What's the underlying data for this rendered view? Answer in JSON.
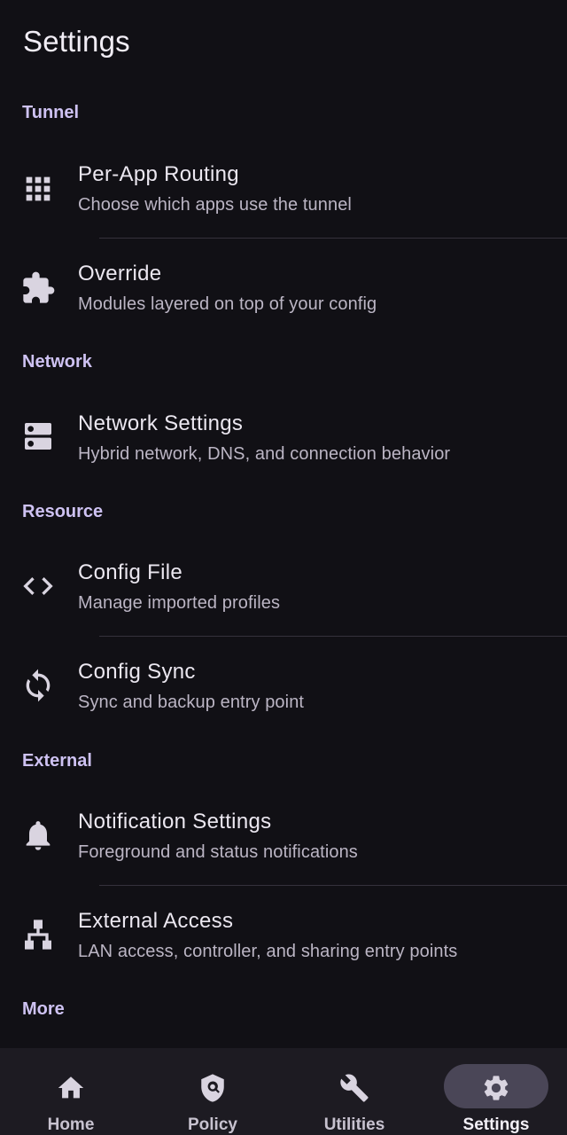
{
  "header": {
    "title": "Settings"
  },
  "sections": {
    "tunnel": "Tunnel",
    "network": "Network",
    "resource": "Resource",
    "external": "External",
    "more": "More"
  },
  "items": {
    "per_app": {
      "title": "Per-App Routing",
      "subtitle": "Choose which apps use the tunnel",
      "icon": "apps-grid-icon"
    },
    "override": {
      "title": "Override",
      "subtitle": "Modules layered on top of your config",
      "icon": "puzzle-icon"
    },
    "network_settings": {
      "title": "Network Settings",
      "subtitle": "Hybrid network, DNS, and connection behavior",
      "icon": "server-icon"
    },
    "config_file": {
      "title": "Config File",
      "subtitle": "Manage imported profiles",
      "icon": "code-icon"
    },
    "config_sync": {
      "title": "Config Sync",
      "subtitle": "Sync and backup entry point",
      "icon": "sync-icon"
    },
    "notification": {
      "title": "Notification Settings",
      "subtitle": "Foreground and status notifications",
      "icon": "bell-icon"
    },
    "external_access": {
      "title": "External Access",
      "subtitle": "LAN access, controller, and sharing entry points",
      "icon": "network-tree-icon"
    }
  },
  "nav": {
    "home": "Home",
    "policy": "Policy",
    "utilities": "Utilities",
    "settings": "Settings",
    "active": "settings"
  },
  "colors": {
    "background": "#111015",
    "accent": "#cec2f2",
    "nav_background": "#1d1b22",
    "active_pill": "#4a4657"
  }
}
